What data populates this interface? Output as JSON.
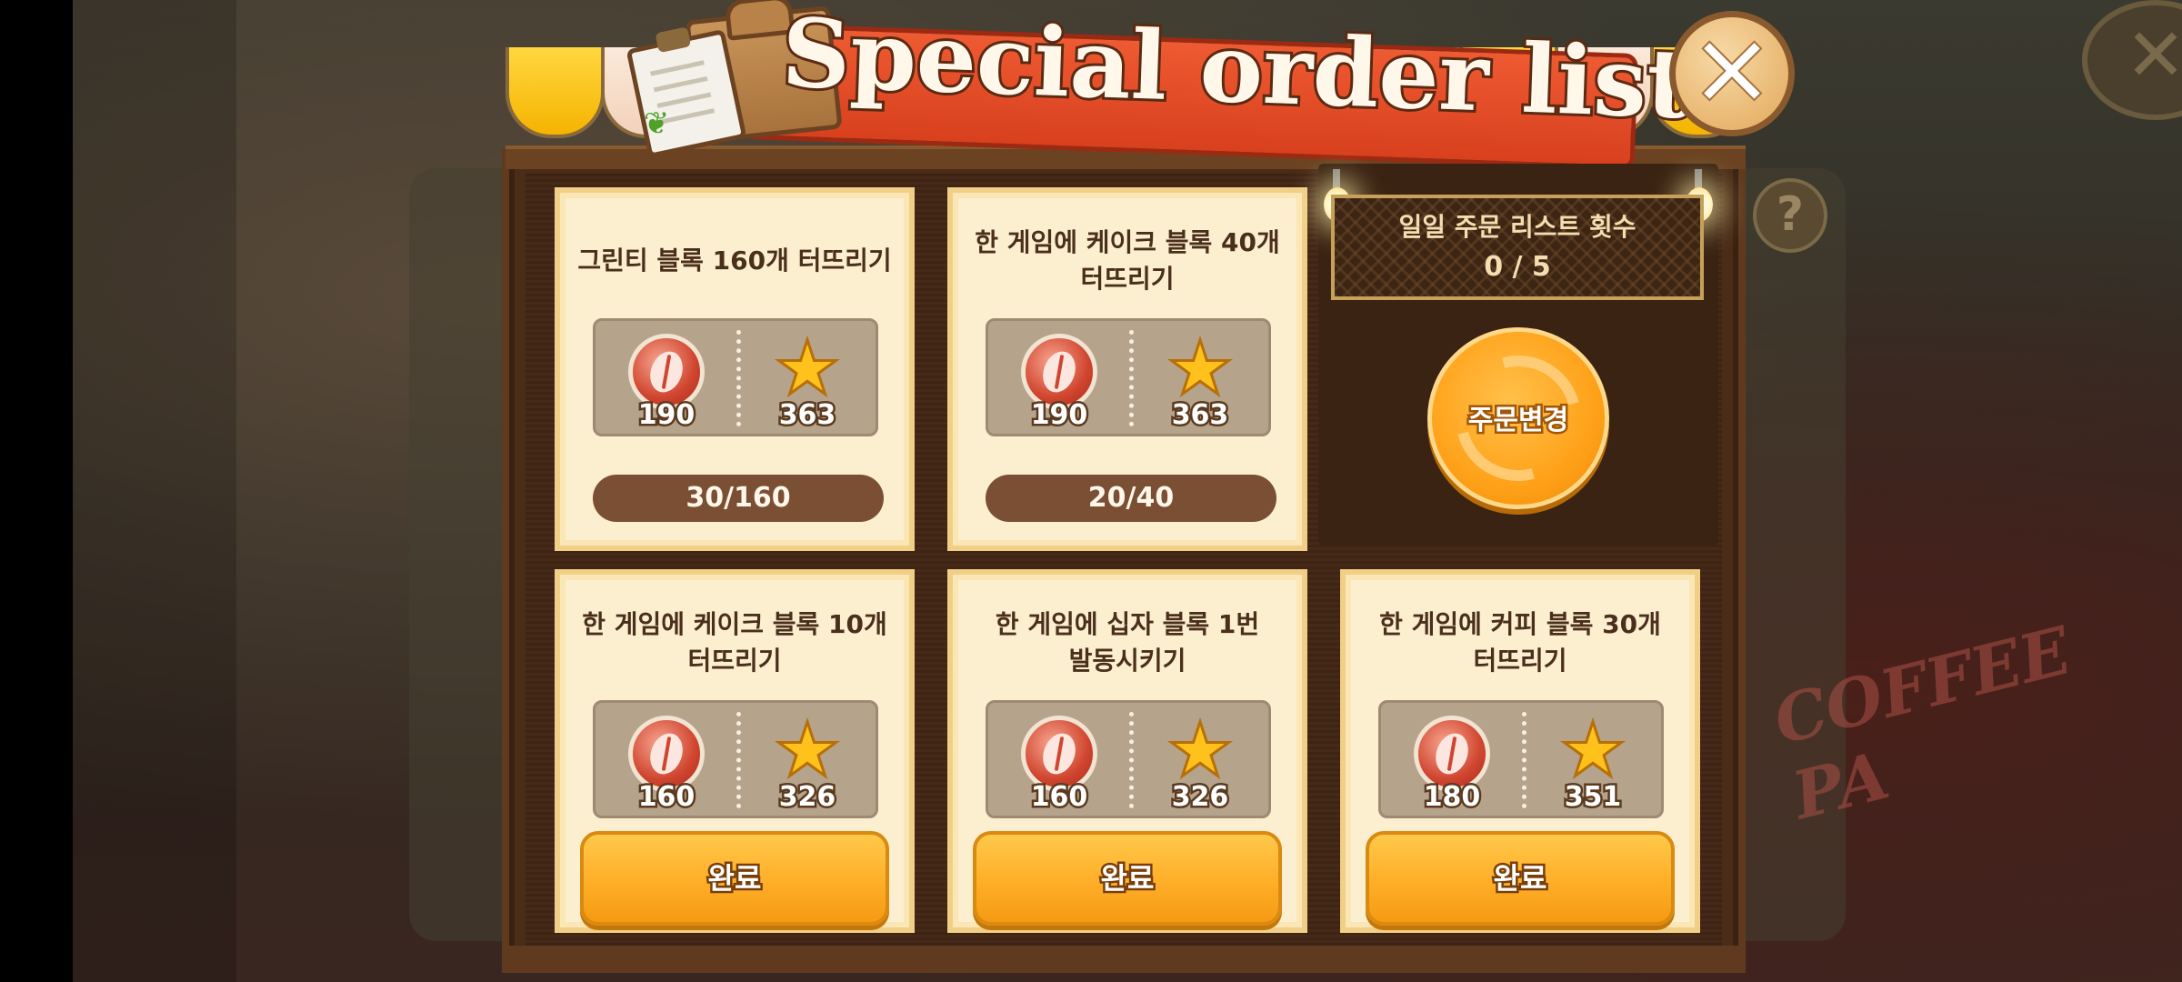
{
  "title": "Special order list",
  "close_symbol": "✕",
  "background": {
    "sign_text": "COFFEE PA",
    "close_symbol": "✕",
    "help_symbol": "?"
  },
  "icons": {
    "coin": "coffee-bean-coin-icon",
    "star": "star-icon",
    "close": "close-icon",
    "refresh": "refresh-icon"
  },
  "colors": {
    "accent_orange": "#ffae28",
    "banner_red": "#e24d28",
    "card_bg": "#fcefcf",
    "progress_bg": "#7b4f34"
  },
  "orders": [
    {
      "desc_line1": "그린티 블록 160개 터뜨리기",
      "desc_line2": "",
      "coins": "190",
      "stars": "363",
      "progress": "30/160",
      "button": ""
    },
    {
      "desc_line1": "한 게임에 케이크 블록 40개",
      "desc_line2": "터뜨리기",
      "coins": "190",
      "stars": "363",
      "progress": "20/40",
      "button": ""
    },
    {
      "desc_line1": "한 게임에 케이크 블록 10개",
      "desc_line2": "터뜨리기",
      "coins": "160",
      "stars": "326",
      "progress": "",
      "button": "완료"
    },
    {
      "desc_line1": "한 게임에 십자 블록 1번",
      "desc_line2": "발동시키기",
      "coins": "160",
      "stars": "326",
      "progress": "",
      "button": "완료"
    },
    {
      "desc_line1": "한 게임에 커피 블록 30개",
      "desc_line2": "터뜨리기",
      "coins": "180",
      "stars": "351",
      "progress": "",
      "button": "완료"
    }
  ],
  "daily": {
    "label": "일일 주문 리스트 횟수",
    "count": "0 / 5",
    "change_button": "주문변경"
  }
}
